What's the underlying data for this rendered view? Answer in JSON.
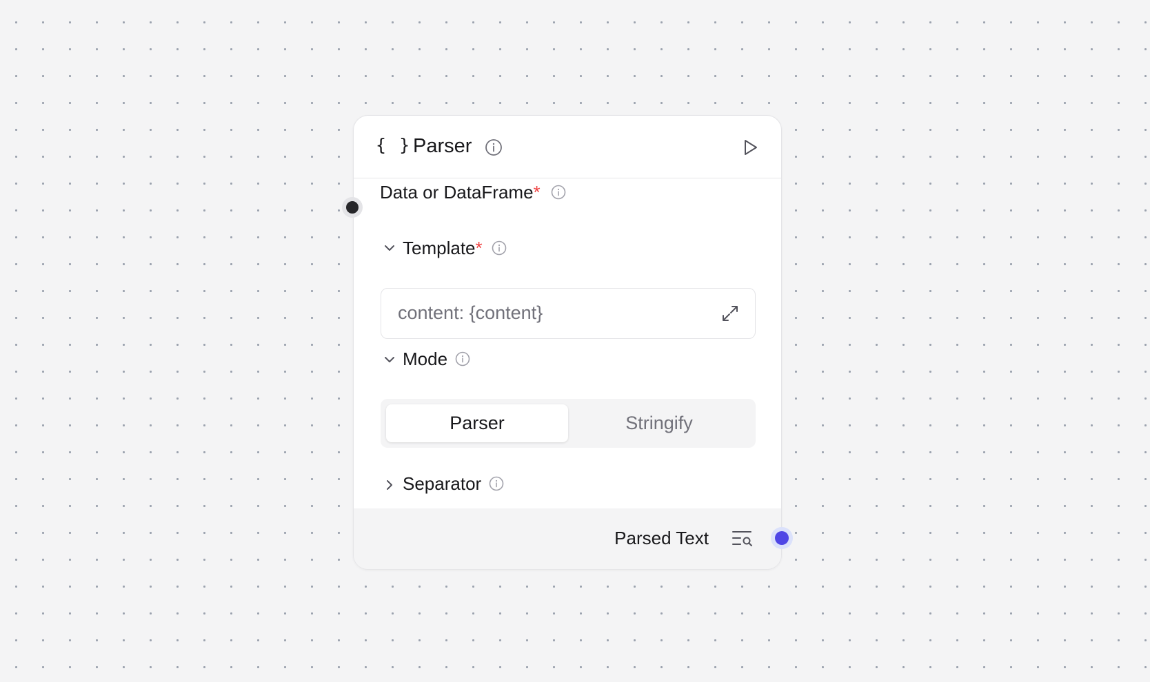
{
  "node": {
    "icon": "{ }",
    "title": "Parser",
    "icons": {
      "header": "curly-braces-icon",
      "info": "info-circle-icon",
      "run": "play-icon",
      "expand": "expand-arrows-icon",
      "inspect": "list-search-icon"
    }
  },
  "fields": {
    "input": {
      "label": "Data or DataFrame",
      "required": "*"
    },
    "template": {
      "label": "Template",
      "required": "*",
      "value": "content: {content}",
      "expanded": true
    },
    "mode": {
      "label": "Mode",
      "options": [
        "Parser",
        "Stringify"
      ],
      "selected": "Parser",
      "expanded": true
    },
    "separator": {
      "label": "Separator",
      "expanded": false
    }
  },
  "output": {
    "label": "Parsed Text"
  },
  "colors": {
    "background": "#f4f4f5",
    "required": "#ef4444",
    "output_handle": "#4f46e5",
    "input_handle": "#27272a"
  }
}
